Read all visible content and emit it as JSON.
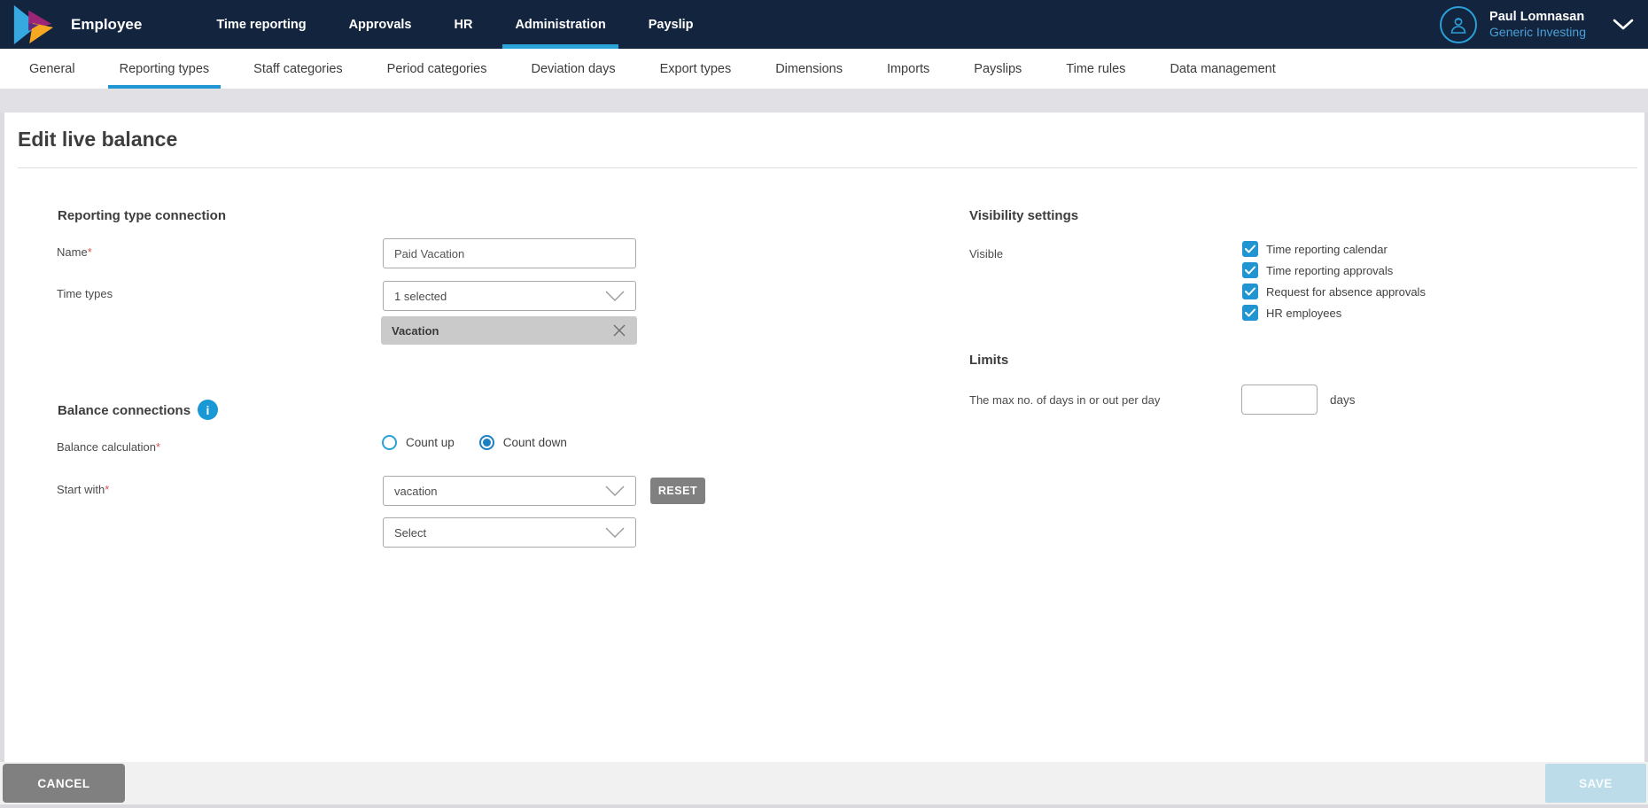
{
  "header": {
    "product": "Employee",
    "nav": [
      {
        "label": "Time reporting",
        "active": false
      },
      {
        "label": "Approvals",
        "active": false
      },
      {
        "label": "HR",
        "active": false
      },
      {
        "label": "Administration",
        "active": true
      },
      {
        "label": "Payslip",
        "active": false
      }
    ],
    "user": {
      "name": "Paul Lomnasan",
      "company": "Generic Investing"
    }
  },
  "tabs": [
    {
      "label": "General",
      "active": false
    },
    {
      "label": "Reporting types",
      "active": true
    },
    {
      "label": "Staff categories",
      "active": false
    },
    {
      "label": "Period categories",
      "active": false
    },
    {
      "label": "Deviation days",
      "active": false
    },
    {
      "label": "Export types",
      "active": false
    },
    {
      "label": "Dimensions",
      "active": false
    },
    {
      "label": "Imports",
      "active": false
    },
    {
      "label": "Payslips",
      "active": false
    },
    {
      "label": "Time rules",
      "active": false
    },
    {
      "label": "Data management",
      "active": false
    }
  ],
  "page": {
    "title": "Edit live balance"
  },
  "form": {
    "reporting_type_connection": {
      "heading": "Reporting type connection",
      "name_label": "Name",
      "required_mark": "*",
      "name_value": "Paid Vacation",
      "time_types_label": "Time types",
      "time_types_value": "1 selected",
      "selected_chip": "Vacation"
    },
    "visibility": {
      "heading": "Visibility settings",
      "visible_label": "Visible",
      "checkboxes": [
        {
          "label": "Time reporting calendar",
          "checked": true
        },
        {
          "label": "Time reporting approvals",
          "checked": true
        },
        {
          "label": "Request for absence approvals",
          "checked": true
        },
        {
          "label": "HR employees",
          "checked": true
        }
      ]
    },
    "limits": {
      "heading": "Limits",
      "max_days_label": "The max no. of days in or out per day",
      "max_days_value": "",
      "unit": "days"
    },
    "balance_connections": {
      "heading": "Balance connections",
      "calc_label": "Balance calculation",
      "required_mark": "*",
      "option_count_up": "Count up",
      "option_count_down": "Count down",
      "selected_option": "Count down",
      "start_with_label": "Start with",
      "start_with_value": "vacation",
      "reset_label": "RESET",
      "second_select_value": "Select"
    }
  },
  "footer": {
    "cancel_label": "CANCEL",
    "save_label": "SAVE"
  },
  "colors": {
    "header_bg": "#13243e",
    "accent_cyan": "#2aa3d8",
    "accent_blue": "#2196d3",
    "checkbox_blue": "#2095d2",
    "radio_blue": "#1b7fc4",
    "button_gray": "#808080",
    "save_disabled": "#bddcea",
    "required_red": "#d9534f"
  }
}
